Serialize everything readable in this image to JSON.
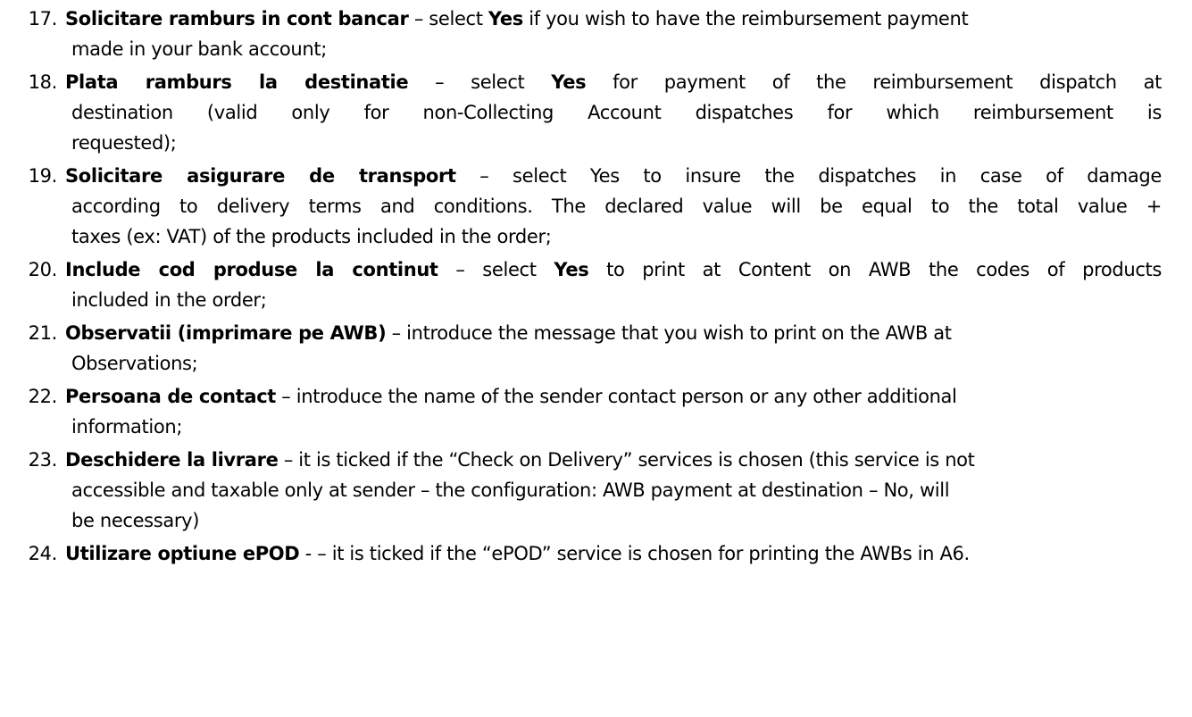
{
  "items": [
    {
      "number": "17.",
      "lines": [
        {
          "title": "Solicitare ramburs in cont bancar",
          "p1": " – select ",
          "b1": "Yes",
          "p2": " if you wish to have the reimbursement payment"
        },
        {
          "text": "made in your bank account;"
        }
      ]
    },
    {
      "number": "18.",
      "lines": [
        {
          "title": "Plata ramburs la destinatie",
          "p1": " – select ",
          "b1": "Yes",
          "p2": " for payment of the reimbursement dispatch at"
        },
        {
          "text": "destination (valid only for non-Collecting Account dispatches for which reimbursement is"
        },
        {
          "text": "requested);"
        }
      ]
    },
    {
      "number": "19.",
      "lines": [
        {
          "title": "Solicitare asigurare de transport",
          "p1": " – select Yes to insure the dispatches in case of damage"
        },
        {
          "text": "according to delivery terms and conditions. The declared value will be equal to the total value +"
        },
        {
          "text": "taxes (ex: VAT) of the products included in the order;"
        }
      ]
    },
    {
      "number": "20.",
      "lines": [
        {
          "title": "Include cod produse la continut",
          "p1": " – select ",
          "b1": "Yes",
          "p2": " to print at Content on AWB the codes of products"
        },
        {
          "text": "included in the order;"
        }
      ]
    },
    {
      "number": "21.",
      "lines": [
        {
          "title": "Observatii (imprimare pe AWB)",
          "p1": " – introduce the message that you wish to print on the AWB at"
        },
        {
          "text": "Observations;"
        }
      ]
    },
    {
      "number": "22.",
      "lines": [
        {
          "title": "Persoana de contact",
          "p1": " – introduce the name of the sender contact person or any other additional"
        },
        {
          "text": "information;"
        }
      ]
    },
    {
      "number": "23.",
      "lines": [
        {
          "title": "Deschidere la livrare",
          "p1": " – it is ticked if the “Check on Delivery” services is chosen (this service is not"
        },
        {
          "text": "accessible and taxable only at sender – the configuration: AWB payment at destination – No, will"
        },
        {
          "text": "be necessary)"
        }
      ]
    },
    {
      "number": "24.",
      "lines": [
        {
          "title": "Utilizare optiune ePOD",
          "p1": " - – it is ticked if the “ePOD” service is chosen for printing the AWBs in A6."
        }
      ]
    }
  ]
}
